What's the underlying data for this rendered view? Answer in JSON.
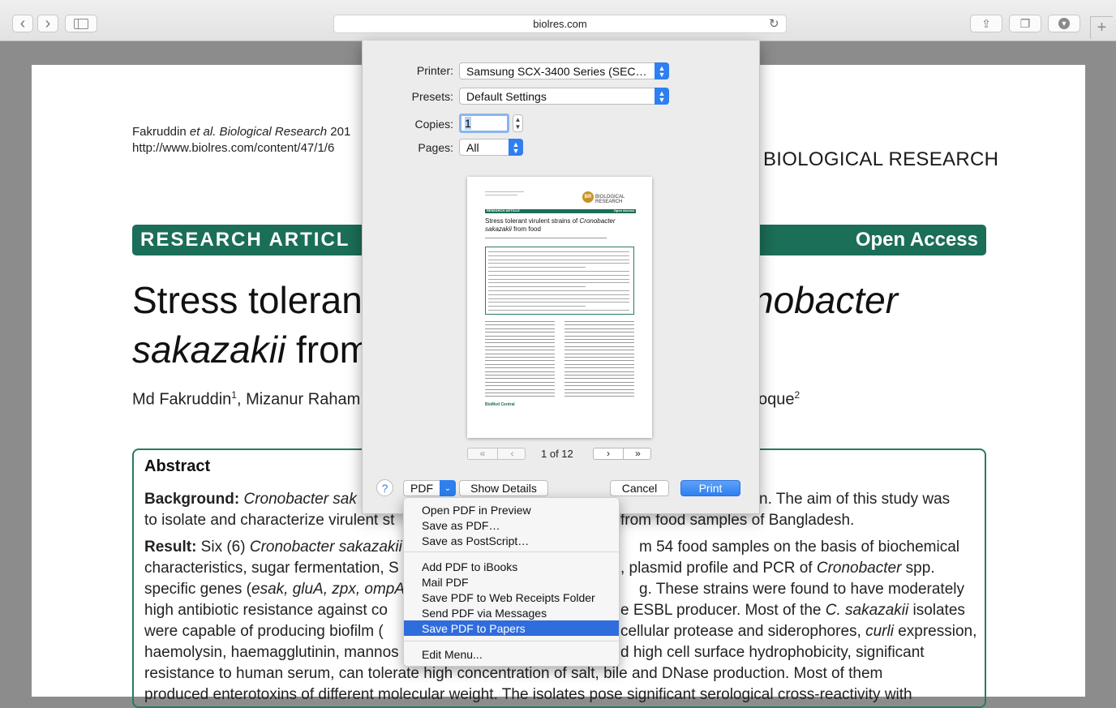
{
  "browser": {
    "url": "biolres.com",
    "nav_back": "‹",
    "nav_forward": "›"
  },
  "document": {
    "citation_prefix": "Fakruddin",
    "citation_etal": " et al. Biological Research",
    "citation_year": " 201",
    "citation_url": "http://www.biolres.com/content/47/1/6",
    "journal": "BIOLOGICAL RESEARCH",
    "banner_left": "RESEARCH ARTICL",
    "banner_right": "Open Access",
    "title_line1_a": "Stress toleran",
    "title_line1_b": "nobacter",
    "title_line2_a": "sakazakii",
    "title_line2_b": " from",
    "authors_a": "Md Fakruddin",
    "authors_sup1": "1",
    "authors_b": ", Mizanur Raham",
    "authors_c": "oque",
    "authors_sup2": "2",
    "abstract_heading": "Abstract",
    "lines": [
      {
        "left_bold": "Background:",
        "left_it": " Cronobacter sak",
        "right": "n. The aim of this study was"
      },
      {
        "left": "to isolate and characterize virulent st",
        "right": "from food samples of Bangladesh."
      },
      {
        "left_bold": "Result:",
        "left": " Six (6) ",
        "left_it": "Cronobacter sakazakii",
        "right": "m 54 food samples on the basis of biochemical"
      },
      {
        "left": "characteristics, sugar fermentation, S",
        "right_a": ", plasmid profile and PCR of ",
        "right_it": "Cronobacter",
        "right_b": " spp."
      },
      {
        "left": "specific genes (",
        "left_it": "esak, gluA, zpx, ompA",
        "right": "g. These strains were found to have moderately"
      },
      {
        "left": "high antibiotic resistance against co",
        "right_a": "e ESBL producer. Most of the ",
        "right_it": "C. sakazakii",
        "right_b": " isolates"
      },
      {
        "left": "were capable of producing biofilm (",
        "right_a": "cellular protease and siderophores, ",
        "right_it": "curli",
        "right_b": " expression,"
      },
      {
        "left": "haemolysin, haemagglutinin, mannos",
        "right": "d high cell surface hydrophobicity, significant"
      },
      {
        "full": "resistance to human serum, can tolerate high concentration of salt, bile and DNase production. Most of them"
      },
      {
        "full": "produced enterotoxins of different molecular weight. The isolates pose significant serological cross-reactivity with"
      }
    ]
  },
  "print_dialog": {
    "printer_label": "Printer:",
    "printer_value": "Samsung SCX-3400 Series (SEC…",
    "presets_label": "Presets:",
    "presets_value": "Default Settings",
    "copies_label": "Copies:",
    "copies_value": "1",
    "pages_label": "Pages:",
    "pages_value": "All",
    "page_indicator": "1 of 12",
    "help": "?",
    "pdf_button": "PDF",
    "show_details": "Show Details",
    "cancel": "Cancel",
    "print": "Print",
    "preview": {
      "header": "BIOLOGICAL RESEARCH",
      "badge": "BR",
      "banner_left": "RESEARCH ARTICLE",
      "banner_right": "Open Access",
      "title_a": "Stress tolerant virulent strains of ",
      "title_it": "Cronobacter",
      "title_line2_it": "sakazakii",
      "title_line2": " from food",
      "footer_logo": "BioMed Central"
    }
  },
  "pdf_menu": {
    "items": [
      "Open PDF in Preview",
      "Save as PDF…",
      "Save as PostScript…",
      "Add PDF to iBooks",
      "Mail PDF",
      "Save PDF to Web Receipts Folder",
      "Send PDF via Messages",
      "Save PDF to Papers",
      "Edit Menu..."
    ],
    "selected": "Save PDF to Papers"
  },
  "colors": {
    "journal_green": "#1b6e57",
    "accent_blue": "#2e7ff0",
    "menu_highlight": "#2f6cdc"
  }
}
